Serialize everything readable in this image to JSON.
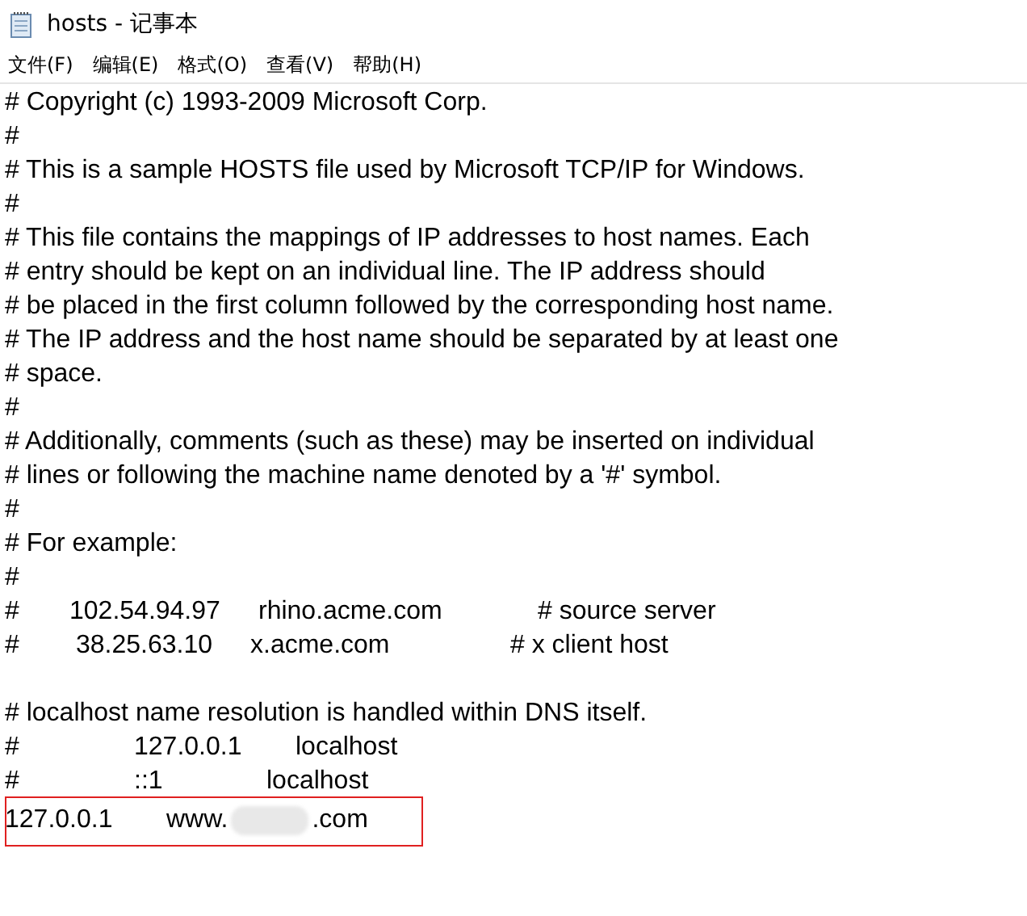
{
  "window": {
    "title": "hosts - 记事本"
  },
  "menu": [
    "文件(F)",
    "编辑(E)",
    "格式(O)",
    "查看(V)",
    "帮助(H)"
  ],
  "lines": [
    {
      "kind": "text",
      "cells": [
        "# Copyright (c) 1993-2009 Microsoft Corp."
      ]
    },
    {
      "kind": "text",
      "cells": [
        "#"
      ]
    },
    {
      "kind": "text",
      "cells": [
        "# This is a sample HOSTS file used by Microsoft TCP/IP for Windows."
      ]
    },
    {
      "kind": "text",
      "cells": [
        "#"
      ]
    },
    {
      "kind": "text",
      "cells": [
        "# This file contains the mappings of IP addresses to host names. Each"
      ]
    },
    {
      "kind": "text",
      "cells": [
        "# entry should be kept on an individual line. The IP address should"
      ]
    },
    {
      "kind": "text",
      "cells": [
        "# be placed in the first column followed by the corresponding host name."
      ]
    },
    {
      "kind": "text",
      "cells": [
        "# The IP address and the host name should be separated by at least one"
      ]
    },
    {
      "kind": "text",
      "cells": [
        "# space."
      ]
    },
    {
      "kind": "text",
      "cells": [
        "#"
      ]
    },
    {
      "kind": "text",
      "cells": [
        "# Additionally, comments (such as these) may be inserted on individual"
      ]
    },
    {
      "kind": "text",
      "cells": [
        "# lines or following the machine name denoted by a '#' symbol."
      ]
    },
    {
      "kind": "text",
      "cells": [
        "#"
      ]
    },
    {
      "kind": "text",
      "cells": [
        "# For example:"
      ]
    },
    {
      "kind": "text",
      "cells": [
        "#"
      ]
    },
    {
      "kind": "columns",
      "cells": [
        "#",
        "102.54.94.97",
        "rhino.acme.com",
        "# source server"
      ]
    },
    {
      "kind": "columns",
      "cells": [
        "#",
        "38.25.63.10",
        "x.acme.com",
        "# x client host"
      ]
    },
    {
      "kind": "blank"
    },
    {
      "kind": "text",
      "cells": [
        "# localhost name resolution is handled within DNS itself."
      ]
    },
    {
      "kind": "columns",
      "cells": [
        "#",
        "127.0.0.1",
        "localhost"
      ]
    },
    {
      "kind": "columns",
      "cells": [
        "#",
        "::1",
        "localhost"
      ]
    },
    {
      "kind": "redacted",
      "cells": [
        "127.0.0.1",
        "www.",
        ".com"
      ],
      "highlighted": true
    }
  ]
}
